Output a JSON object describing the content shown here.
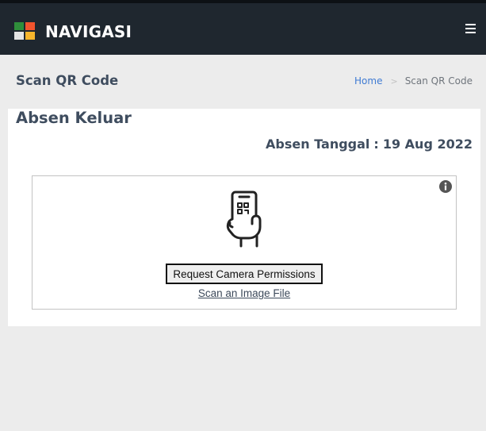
{
  "header": {
    "brand": "NAVIGASI",
    "logo_colors": [
      "#2f8e3b",
      "#f2542d",
      "#e4e4e4",
      "#f7b52c"
    ],
    "menu_icon": "hamburger-icon"
  },
  "page": {
    "title": "Scan QR Code",
    "breadcrumb": {
      "home": "Home",
      "separator": ">",
      "current": "Scan QR Code"
    }
  },
  "card": {
    "title": "Absen Keluar",
    "date_label": "Absen Tanggal",
    "date_separator": ":",
    "date_value": "19 Aug 2022"
  },
  "scanner": {
    "info_icon": "info-icon",
    "phone_icon": "phone-qr-icon",
    "request_button": "Request Camera Permissions",
    "scan_file_link": "Scan an Image File"
  },
  "colors": {
    "topbar": "#1f272f",
    "background": "#ececec",
    "link": "#3f7bd3",
    "heading": "#3f4d5f"
  }
}
